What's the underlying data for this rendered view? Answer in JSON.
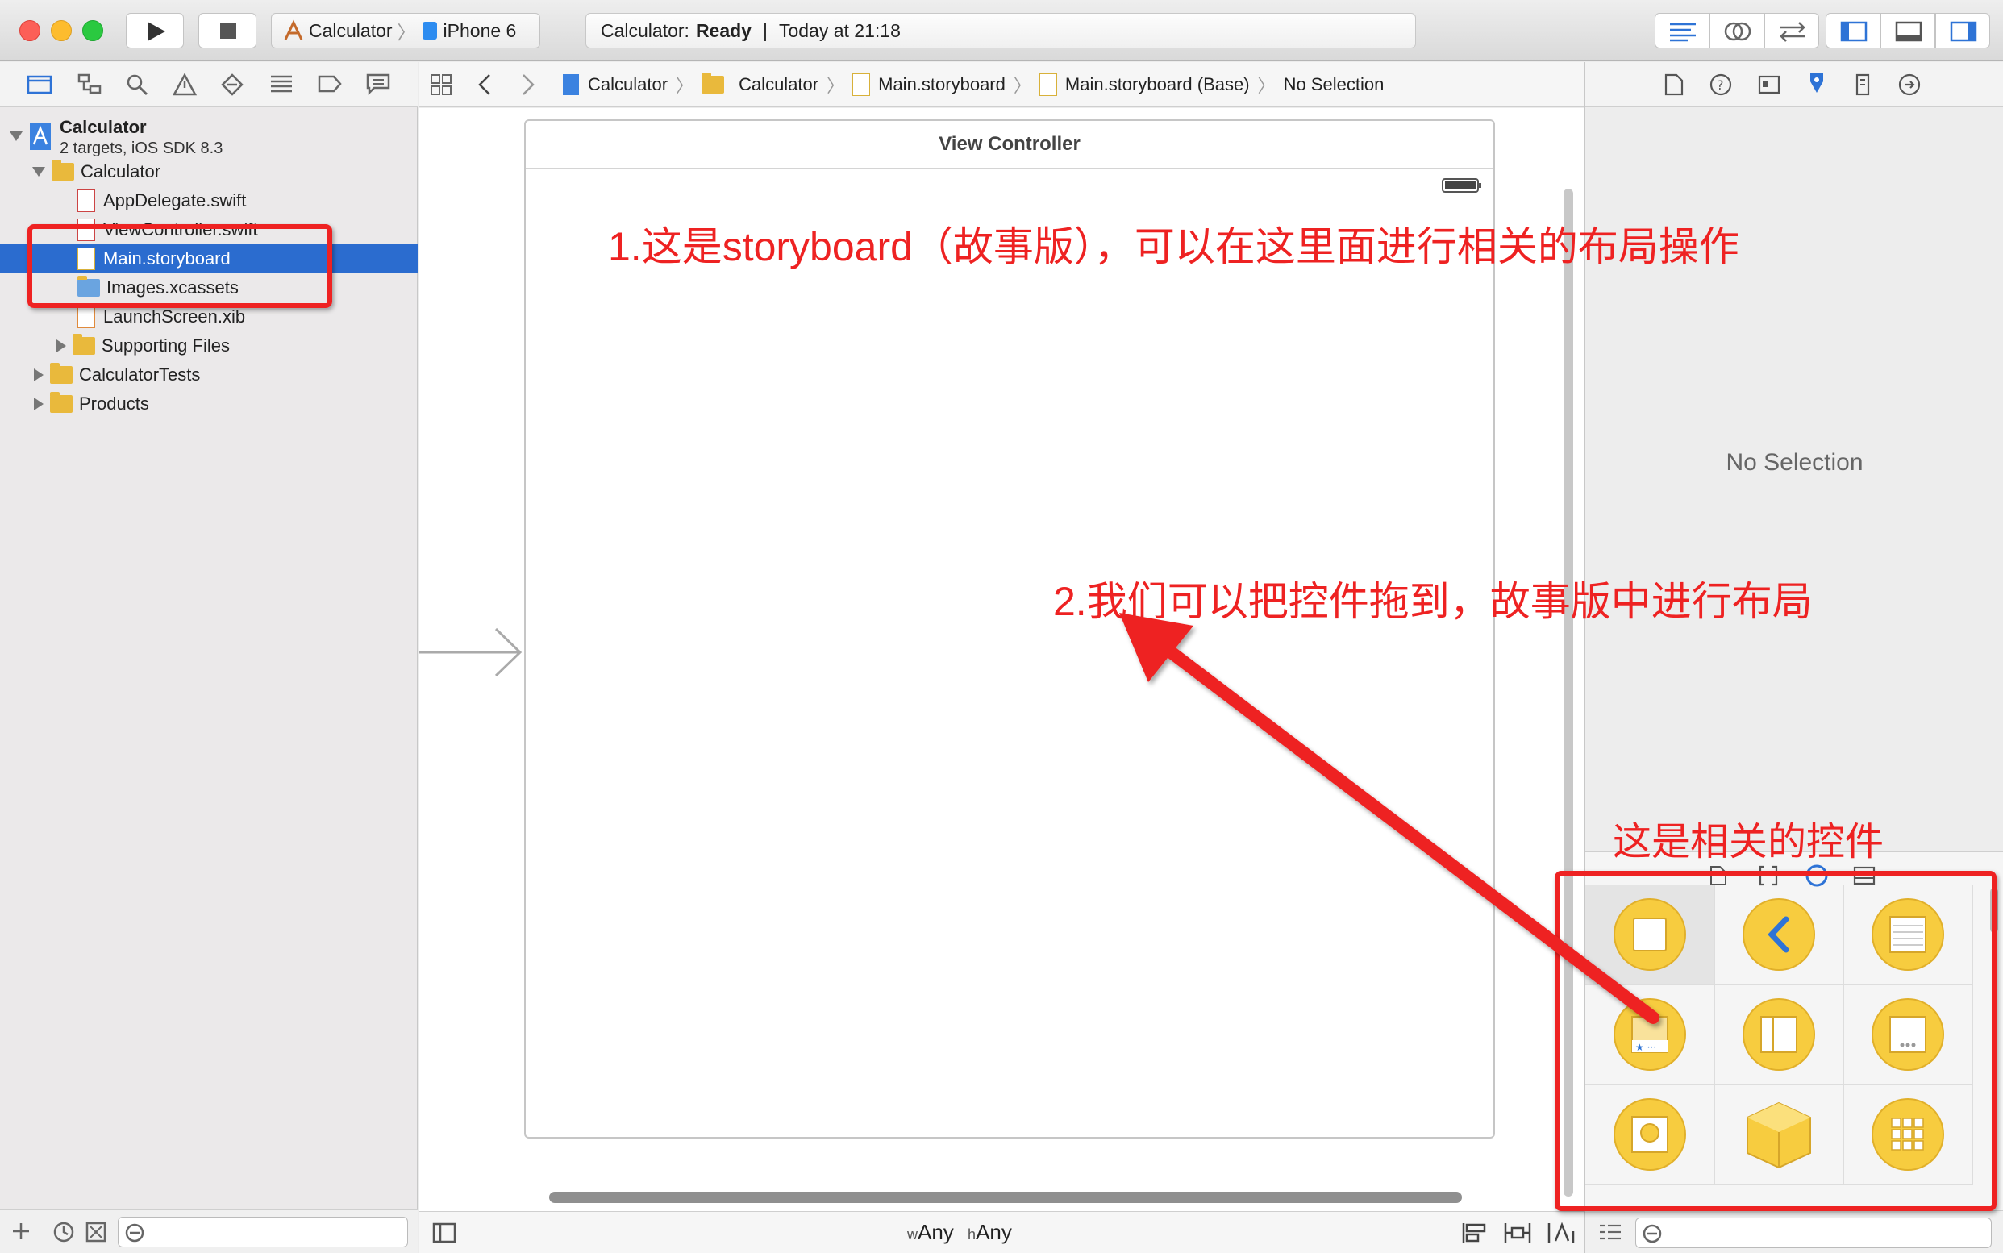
{
  "toolbar": {
    "scheme_target": "Calculator",
    "scheme_device": "iPhone 6",
    "status_prefix": "Calculator:",
    "status_state": "Ready",
    "status_separator": "|",
    "status_time": "Today at 21:18"
  },
  "navigator": {
    "project_name": "Calculator",
    "project_subtitle": "2 targets, iOS SDK 8.3",
    "items": [
      {
        "label": "Calculator"
      },
      {
        "label": "AppDelegate.swift"
      },
      {
        "label": "ViewController.swift"
      },
      {
        "label": "Main.storyboard"
      },
      {
        "label": "Images.xcassets"
      },
      {
        "label": "LaunchScreen.xib"
      },
      {
        "label": "Supporting Files"
      },
      {
        "label": "CalculatorTests"
      },
      {
        "label": "Products"
      }
    ]
  },
  "jumpbar": {
    "crumbs": [
      "Calculator",
      "Calculator",
      "Main.storyboard",
      "Main.storyboard (Base)",
      "No Selection"
    ]
  },
  "editor": {
    "scene_title": "View Controller",
    "size_w_prefix": "w",
    "size_w_value": "Any",
    "size_h_prefix": "h",
    "size_h_value": "Any"
  },
  "inspector": {
    "empty_text": "No Selection"
  },
  "annotations": {
    "note1": "1.这是storyboard（故事版），可以在这里面进行相关的布局操作",
    "note2": "2.我们可以把控件拖到，故事版中进行布局",
    "note3": "这是相关的控件"
  },
  "colors": {
    "selection": "#2b6ccf",
    "annotation": "#ee2222",
    "object_yellow": "#f7cc3f",
    "object_blue": "#2e73d6"
  }
}
